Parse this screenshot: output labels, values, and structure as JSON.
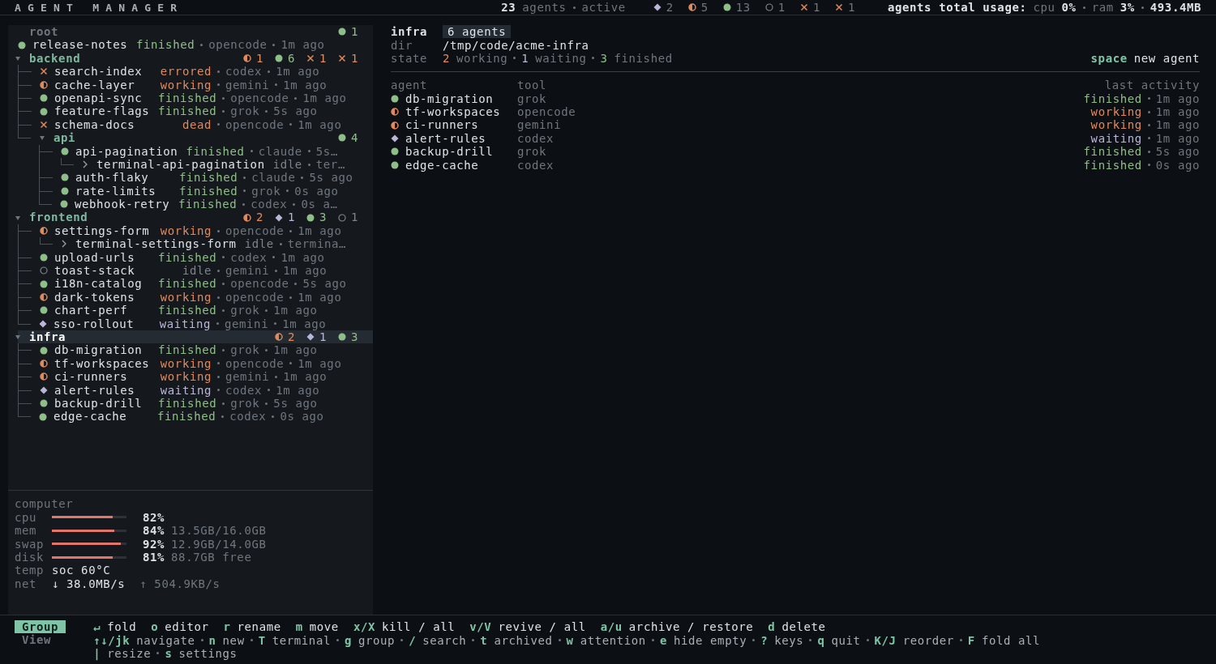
{
  "header": {
    "title": "AGENT MANAGER",
    "agent_count": "23",
    "agent_label": "agents",
    "mode": "active",
    "counts": [
      {
        "kind": "waiting",
        "count": "2"
      },
      {
        "kind": "working",
        "count": "5"
      },
      {
        "kind": "finished",
        "count": "13"
      },
      {
        "kind": "idle",
        "count": "1"
      },
      {
        "kind": "errored",
        "count": "1"
      },
      {
        "kind": "dead",
        "count": "1"
      }
    ],
    "usage_label": "agents total usage:",
    "usage": [
      {
        "label": "cpu",
        "value": "0%"
      },
      {
        "label": "ram",
        "value": "3%"
      }
    ],
    "memory": "493.4MB"
  },
  "tree": [
    {
      "name": "root",
      "selected": false,
      "counts": [
        {
          "kind": "finished",
          "count": "1"
        }
      ],
      "children": [
        {
          "name": "release-notes",
          "kind": "finished",
          "status": "finished",
          "tool": "opencode",
          "time": "1m ago",
          "selected": false
        }
      ]
    },
    {
      "name": "backend",
      "expanded": true,
      "selected": false,
      "counts": [
        {
          "kind": "working",
          "count": "1"
        },
        {
          "kind": "finished",
          "count": "6"
        },
        {
          "kind": "errored",
          "count": "1"
        },
        {
          "kind": "dead",
          "count": "1"
        }
      ],
      "children": [
        {
          "name": "search-index",
          "kind": "errored",
          "status": "errored",
          "tool": "codex",
          "time": "1m ago",
          "selected": false
        },
        {
          "name": "cache-layer",
          "kind": "working",
          "status": "working",
          "tool": "gemini",
          "time": "1m ago",
          "selected": false
        },
        {
          "name": "openapi-sync",
          "kind": "finished",
          "status": "finished",
          "tool": "opencode",
          "time": "1m ago",
          "selected": false
        },
        {
          "name": "feature-flags",
          "kind": "finished",
          "status": "finished",
          "tool": "grok",
          "time": "5s ago",
          "selected": false
        },
        {
          "name": "schema-docs",
          "kind": "dead",
          "status": "dead",
          "tool": "opencode",
          "time": "1m ago",
          "selected": false
        },
        {
          "name": "api",
          "expanded": true,
          "selected": false,
          "counts": [
            {
              "kind": "finished",
              "count": "4"
            }
          ],
          "children": [
            {
              "name": "api-pagination",
              "kind": "finished",
              "status": "finished",
              "tool": "claude",
              "time": "5s…",
              "selected": false,
              "terminals": [
                {
                  "name": "terminal-api-pagination",
                  "kind": "idle",
                  "status": "idle",
                  "tool": "ter…",
                  "selected": false
                }
              ]
            },
            {
              "name": "auth-flaky",
              "kind": "finished",
              "status": "finished",
              "tool": "claude",
              "time": "5s ago",
              "selected": false
            },
            {
              "name": "rate-limits",
              "kind": "finished",
              "status": "finished",
              "tool": "grok",
              "time": "0s ago",
              "selected": false
            },
            {
              "name": "webhook-retry",
              "kind": "finished",
              "status": "finished",
              "tool": "codex",
              "time": "0s a…",
              "selected": false
            }
          ]
        }
      ]
    },
    {
      "name": "frontend",
      "expanded": true,
      "selected": false,
      "counts": [
        {
          "kind": "working",
          "count": "2"
        },
        {
          "kind": "waiting",
          "count": "1"
        },
        {
          "kind": "finished",
          "count": "3"
        },
        {
          "kind": "idle",
          "count": "1"
        }
      ],
      "children": [
        {
          "name": "settings-form",
          "kind": "working",
          "status": "working",
          "tool": "opencode",
          "time": "1m ago",
          "selected": false,
          "terminals": [
            {
              "name": "terminal-settings-form",
              "kind": "idle",
              "status": "idle",
              "tool": "termina…",
              "selected": false
            }
          ]
        },
        {
          "name": "upload-urls",
          "kind": "finished",
          "status": "finished",
          "tool": "codex",
          "time": "1m ago",
          "selected": false
        },
        {
          "name": "toast-stack",
          "kind": "idle",
          "status": "idle",
          "tool": "gemini",
          "time": "1m ago",
          "selected": false
        },
        {
          "name": "i18n-catalog",
          "kind": "finished",
          "status": "finished",
          "tool": "opencode",
          "time": "5s ago",
          "selected": false
        },
        {
          "name": "dark-tokens",
          "kind": "working",
          "status": "working",
          "tool": "opencode",
          "time": "1m ago",
          "selected": false
        },
        {
          "name": "chart-perf",
          "kind": "finished",
          "status": "finished",
          "tool": "grok",
          "time": "1m ago",
          "selected": false
        },
        {
          "name": "sso-rollout",
          "kind": "waiting",
          "status": "waiting",
          "tool": "gemini",
          "time": "1m ago",
          "selected": false
        }
      ]
    },
    {
      "name": "infra",
      "expanded": true,
      "selected": true,
      "counts": [
        {
          "kind": "working",
          "count": "2"
        },
        {
          "kind": "waiting",
          "count": "1"
        },
        {
          "kind": "finished",
          "count": "3"
        }
      ],
      "children": [
        {
          "name": "db-migration",
          "kind": "finished",
          "status": "finished",
          "tool": "grok",
          "time": "1m ago",
          "selected": false
        },
        {
          "name": "tf-workspaces",
          "kind": "working",
          "status": "working",
          "tool": "opencode",
          "time": "1m ago",
          "selected": false
        },
        {
          "name": "ci-runners",
          "kind": "working",
          "status": "working",
          "tool": "gemini",
          "time": "1m ago",
          "selected": false
        },
        {
          "name": "alert-rules",
          "kind": "waiting",
          "status": "waiting",
          "tool": "codex",
          "time": "1m ago",
          "selected": false
        },
        {
          "name": "backup-drill",
          "kind": "finished",
          "status": "finished",
          "tool": "grok",
          "time": "5s ago",
          "selected": false
        },
        {
          "name": "edge-cache",
          "kind": "finished",
          "status": "finished",
          "tool": "codex",
          "time": "0s ago",
          "selected": false
        }
      ]
    }
  ],
  "computer": {
    "title": "computer",
    "meters": [
      {
        "label": "cpu",
        "level": 0.82,
        "percent": "82%"
      },
      {
        "label": "mem",
        "level": 0.84,
        "percent": "84%",
        "detail": "13.5GB/16.0GB"
      },
      {
        "label": "swap",
        "level": 0.92,
        "percent": "92%",
        "detail": "12.9GB/14.0GB"
      },
      {
        "label": "disk",
        "level": 0.81,
        "percent": "81%",
        "detail": "88.7GB free"
      }
    ],
    "temp": {
      "label": "temp",
      "value": "soc 60°C"
    },
    "net": {
      "label": "net",
      "down": "↓ 38.0MB/s",
      "up": "↑ 504.9KB/s"
    }
  },
  "detail": {
    "name": "infra",
    "badge": "6 agents",
    "dir_label": "dir",
    "dir": "/tmp/code/acme-infra",
    "state_label": "state",
    "state": [
      {
        "kind": "working",
        "count": "2",
        "label": "working"
      },
      {
        "kind": "waiting",
        "count": "1",
        "label": "waiting"
      },
      {
        "kind": "finished",
        "count": "3",
        "label": "finished"
      }
    ],
    "hint": {
      "key": "space",
      "label": "new agent"
    },
    "columns": [
      "agent",
      "tool",
      "last activity"
    ],
    "rows": [
      {
        "name": "db-migration",
        "kind": "finished",
        "tool": "grok",
        "status": "finished",
        "time": "1m ago"
      },
      {
        "name": "tf-workspaces",
        "kind": "working",
        "tool": "opencode",
        "status": "working",
        "time": "1m ago"
      },
      {
        "name": "ci-runners",
        "kind": "working",
        "tool": "gemini",
        "status": "working",
        "time": "1m ago"
      },
      {
        "name": "alert-rules",
        "kind": "waiting",
        "tool": "codex",
        "status": "waiting",
        "time": "1m ago"
      },
      {
        "name": "backup-drill",
        "kind": "finished",
        "tool": "grok",
        "status": "finished",
        "time": "5s ago"
      },
      {
        "name": "edge-cache",
        "kind": "finished",
        "tool": "codex",
        "status": "finished",
        "time": "0s ago"
      }
    ]
  },
  "footer": {
    "modes": [
      {
        "label": "Group",
        "selected": true
      },
      {
        "label": "View",
        "selected": false
      }
    ],
    "lines": [
      {
        "kind": "gap",
        "keys": [
          {
            "key": "↵",
            "label": "fold"
          },
          {
            "key": "o",
            "label": "editor"
          },
          {
            "key": "r",
            "label": "rename"
          },
          {
            "key": "m",
            "label": "move"
          },
          {
            "key": "x/X",
            "label": "kill / all"
          },
          {
            "key": "v/V",
            "label": "revive / all"
          },
          {
            "key": "a/u",
            "label": "archive / restore"
          },
          {
            "key": "d",
            "label": "delete"
          }
        ]
      },
      {
        "kind": "dot",
        "keys": [
          {
            "key": "↑↓/jk",
            "label": "navigate"
          },
          {
            "key": "n",
            "label": "new"
          },
          {
            "key": "T",
            "label": "terminal"
          },
          {
            "key": "g",
            "label": "group"
          },
          {
            "key": "/",
            "label": "search"
          },
          {
            "key": "t",
            "label": "archived"
          },
          {
            "key": "w",
            "label": "attention"
          },
          {
            "key": "e",
            "label": "hide empty"
          },
          {
            "key": "?",
            "label": "keys"
          },
          {
            "key": "q",
            "label": "quit"
          },
          {
            "key": "K/J",
            "label": "reorder"
          },
          {
            "key": "F",
            "label": "fold all"
          }
        ]
      },
      {
        "kind": "dot",
        "keys": [
          {
            "key": "|",
            "label": "resize"
          },
          {
            "key": "s",
            "label": "settings"
          }
        ]
      }
    ]
  }
}
